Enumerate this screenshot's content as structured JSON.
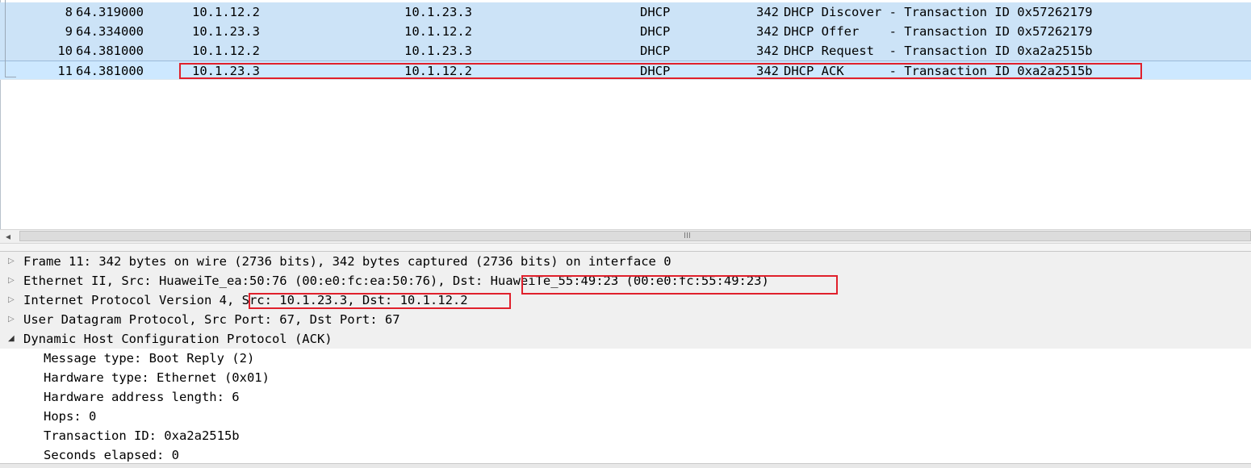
{
  "packet_list": {
    "rows": [
      {
        "no": "8",
        "time": "64.319000",
        "src": "10.1.12.2",
        "dst": "10.1.23.3",
        "proto": "DHCP",
        "len": "342",
        "info": "DHCP Discover - Transaction ID 0x57262179"
      },
      {
        "no": "9",
        "time": "64.334000",
        "src": "10.1.23.3",
        "dst": "10.1.12.2",
        "proto": "DHCP",
        "len": "342",
        "info": "DHCP Offer    - Transaction ID 0x57262179"
      },
      {
        "no": "10",
        "time": "64.381000",
        "src": "10.1.12.2",
        "dst": "10.1.23.3",
        "proto": "DHCP",
        "len": "342",
        "info": "DHCP Request  - Transaction ID 0xa2a2515b"
      },
      {
        "no": "11",
        "time": "64.381000",
        "src": "10.1.23.3",
        "dst": "10.1.12.2",
        "proto": "DHCP",
        "len": "342",
        "info": "DHCP ACK      - Transaction ID 0xa2a2515b"
      }
    ]
  },
  "scrollbar": {
    "left_arrow": "◂",
    "grip": "III"
  },
  "details": {
    "frame": "Frame 11: 342 bytes on wire (2736 bits), 342 bytes captured (2736 bits) on interface 0",
    "ethernet": "Ethernet II, Src: HuaweiTe_ea:50:76 (00:e0:fc:ea:50:76), Dst: HuaweiTe_55:49:23 (00:e0:fc:55:49:23)",
    "ip": "Internet Protocol Version 4, Src: 10.1.23.3, Dst: 10.1.12.2",
    "udp": "User Datagram Protocol, Src Port: 67, Dst Port: 67",
    "dhcp": "Dynamic Host Configuration Protocol (ACK)",
    "dhcp_fields": [
      "Message type: Boot Reply (2)",
      "Hardware type: Ethernet (0x01)",
      "Hardware address length: 6",
      "Hops: 0",
      "Transaction ID: 0xa2a2515b",
      "Seconds elapsed: 0"
    ],
    "collapsed_arrow": "▷",
    "expanded_arrow": "◢"
  },
  "colors": {
    "selection": "#cde8ff",
    "row": "#cce3f7",
    "highlight_box": "#e0202c"
  }
}
